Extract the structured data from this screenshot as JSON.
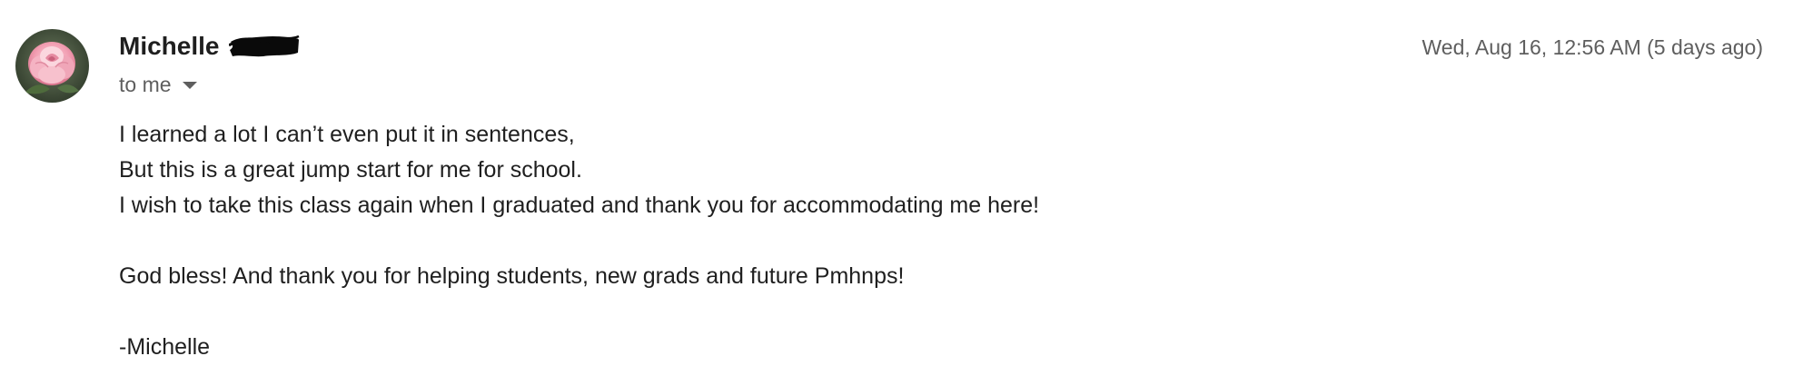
{
  "message": {
    "sender": {
      "name": "Michelle",
      "avatar": "rose-avatar"
    },
    "recipients_label": "to me",
    "timestamp": "Wed, Aug 16, 12:56 AM (5 days ago)",
    "body_lines": [
      "I learned a lot I can’t even put it in sentences,",
      "But this is a great jump start for me for school.",
      "I wish to take this class again when I graduated and thank you for accommodating me here!",
      "",
      "God bless! And thank you for helping students, new grads and future Pmhnps!",
      "",
      "-Michelle"
    ]
  },
  "colors": {
    "primary_text": "#1f1f1f",
    "secondary_text": "#5e5e5e",
    "background": "#ffffff"
  }
}
